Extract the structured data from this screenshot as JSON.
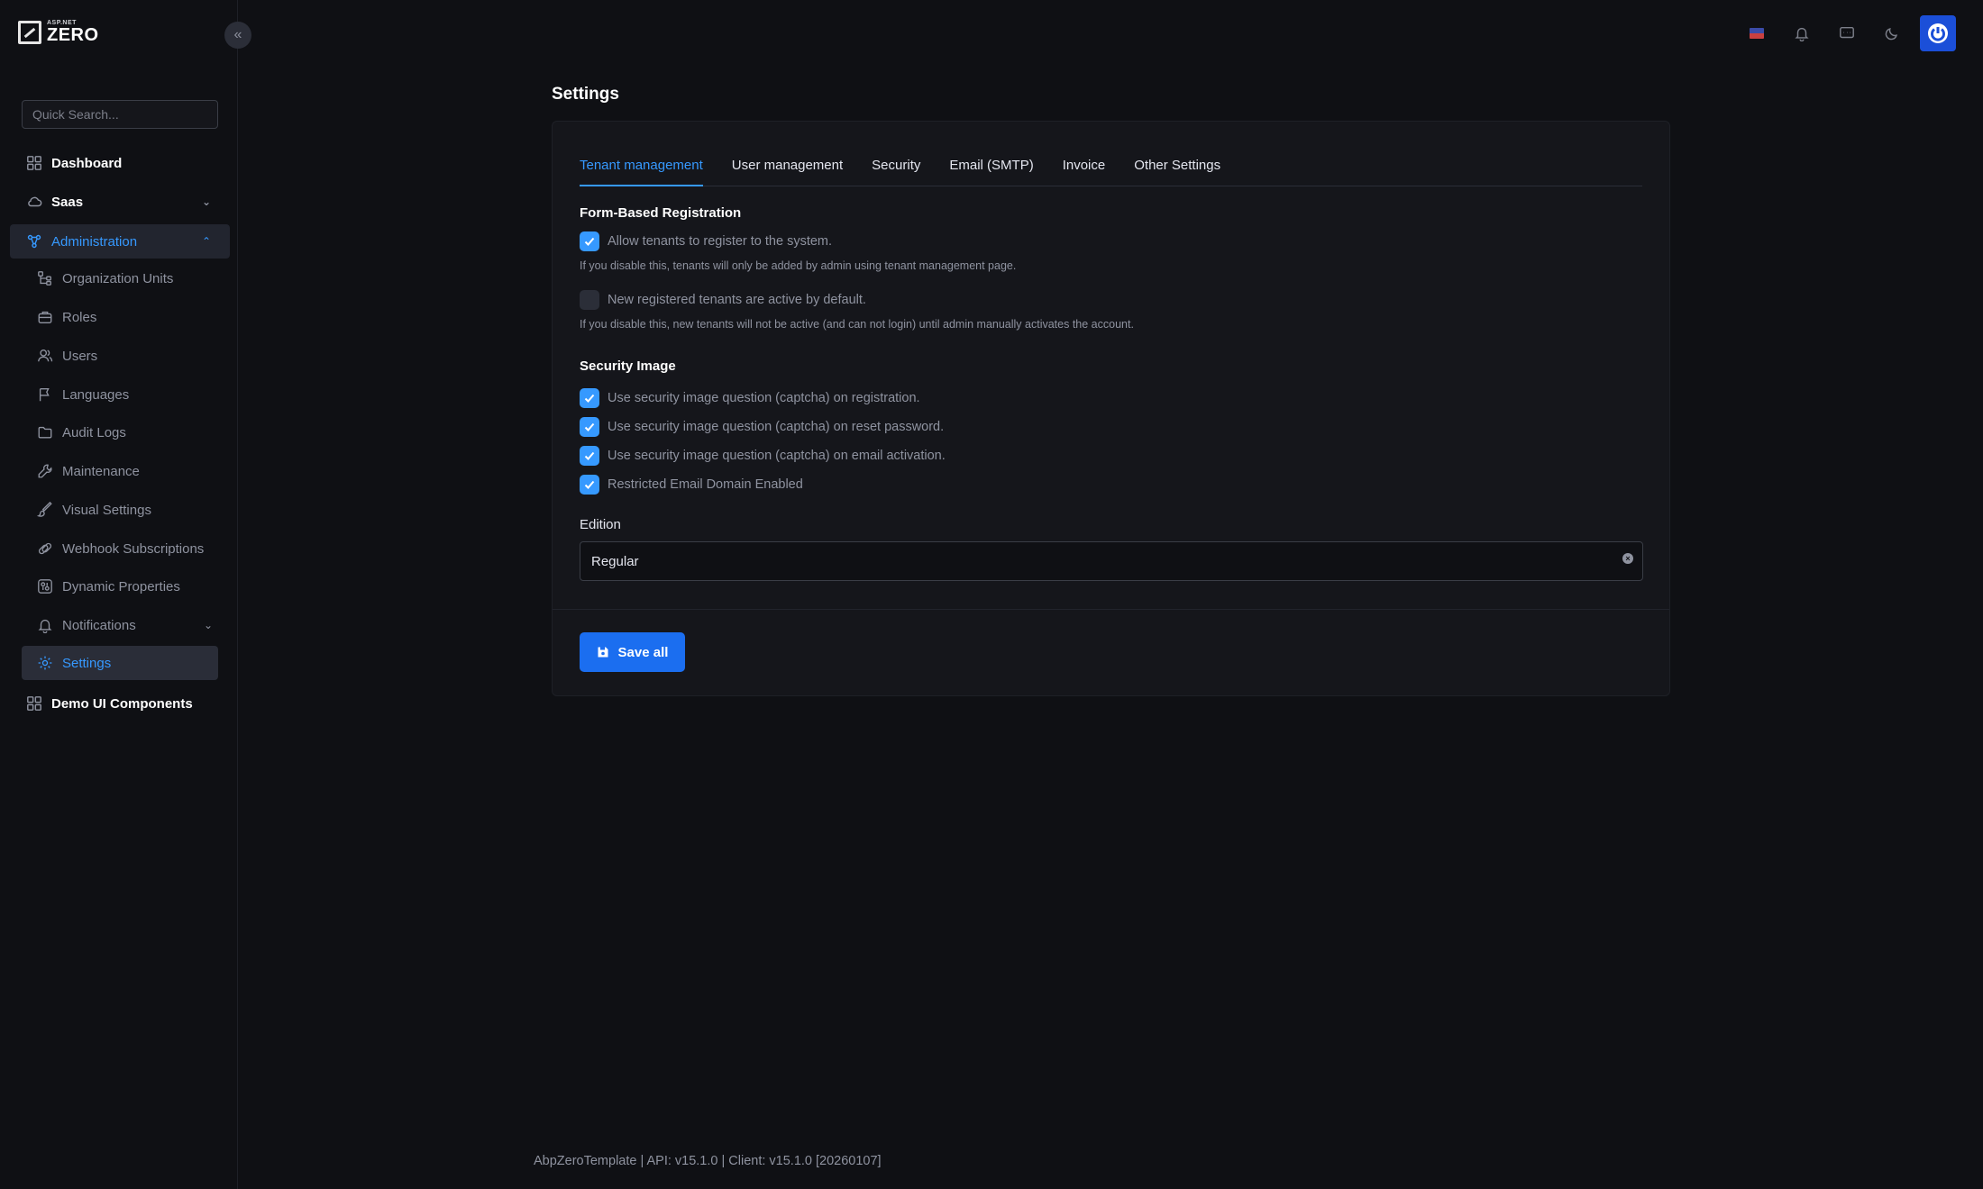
{
  "brand": {
    "small": "ASP.NET",
    "big": "ZERO"
  },
  "search": {
    "placeholder": "Quick Search..."
  },
  "menu": {
    "dashboard": "Dashboard",
    "saas": "Saas",
    "administration": "Administration",
    "sub": [
      {
        "label": "Organization Units",
        "icon": "org-units-icon"
      },
      {
        "label": "Roles",
        "icon": "roles-icon"
      },
      {
        "label": "Users",
        "icon": "users-icon"
      },
      {
        "label": "Languages",
        "icon": "flag-icon"
      },
      {
        "label": "Audit Logs",
        "icon": "folder-icon"
      },
      {
        "label": "Maintenance",
        "icon": "wrench-icon"
      },
      {
        "label": "Visual Settings",
        "icon": "brush-icon"
      },
      {
        "label": "Webhook Subscriptions",
        "icon": "webhook-icon"
      },
      {
        "label": "Dynamic Properties",
        "icon": "dynamic-icon"
      },
      {
        "label": "Notifications",
        "icon": "bell-icon"
      },
      {
        "label": "Settings",
        "icon": "gear-icon"
      }
    ],
    "demo": "Demo UI Components"
  },
  "page": {
    "title": "Settings"
  },
  "tabs": [
    "Tenant management",
    "User management",
    "Security",
    "Email (SMTP)",
    "Invoice",
    "Other Settings"
  ],
  "registration": {
    "title": "Form-Based Registration",
    "allow_label": "Allow tenants to register to the system.",
    "allow_hint": "If you disable this, tenants will only be added by admin using tenant management page.",
    "active_label": "New registered tenants are active by default.",
    "active_hint": "If you disable this, new tenants will not be active (and can not login) until admin manually activates the account."
  },
  "security_image": {
    "title": "Security Image",
    "options": [
      "Use security image question (captcha) on registration.",
      "Use security image question (captcha) on reset password.",
      "Use security image question (captcha) on email activation.",
      "Restricted Email Domain Enabled"
    ]
  },
  "edition": {
    "label": "Edition",
    "value": "Regular"
  },
  "actions": {
    "save_all": "Save all"
  },
  "footer": {
    "text": "AbpZeroTemplate | API: v15.1.0 | Client: v15.1.0 [20260107]"
  },
  "colors": {
    "accent": "#3699ff",
    "primary_button": "#1b6ef0",
    "background": "#0f1014"
  }
}
